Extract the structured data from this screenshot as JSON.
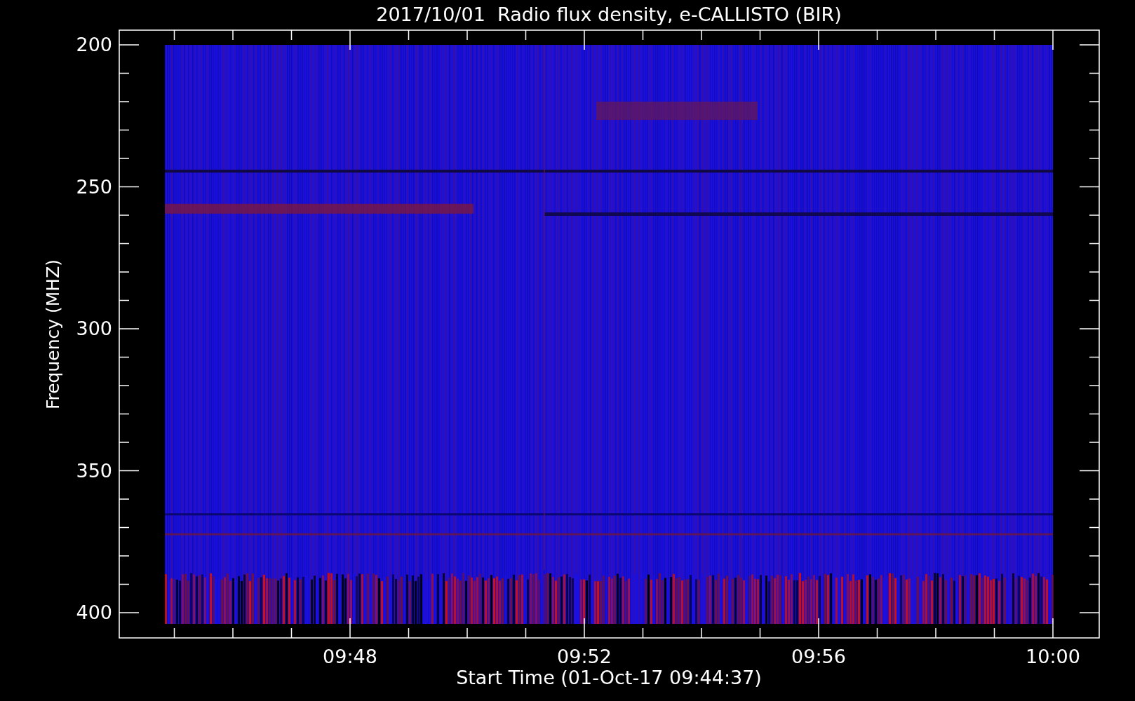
{
  "title": "2017/10/01  Radio flux density, e-CALLISTO (BIR)",
  "y_axis": {
    "label": "Frequency (MHZ)",
    "ticks": [
      "200",
      "250",
      "300",
      "350",
      "400"
    ]
  },
  "x_axis": {
    "label": "Start Time (01-Oct-17 09:44:37)",
    "ticks": [
      "09:48",
      "09:52",
      "09:56",
      "10:00"
    ]
  }
}
